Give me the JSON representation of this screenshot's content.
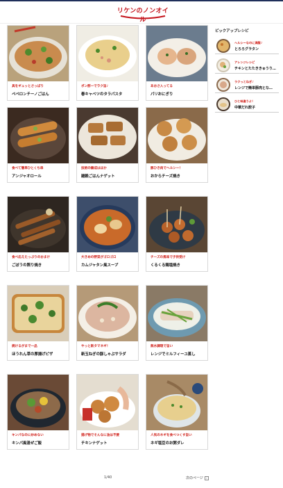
{
  "header": {
    "logo_text": "リケンのノンオイル"
  },
  "sidebar": {
    "heading": "ピックアップレシピ",
    "items": [
      {
        "tag": "ヘルシーなのに満腹♪",
        "title": "とろろグラタン"
      },
      {
        "tag": "アレンジレシピ",
        "title": "チキンとたたききゅうり…"
      },
      {
        "tag": "ラクっとねぎ♪",
        "title": "レンジで簡単豚肉とな…"
      },
      {
        "tag": "ひと味違うよ！",
        "title": "中華だれ餃子"
      }
    ]
  },
  "recipes": [
    {
      "tag": "具をギュッとさっぱり",
      "title": "ペペロンチーノごはん"
    },
    {
      "tag": "ポン酢ーでラク旨♪",
      "title": "春キャベツのタラパスタ"
    },
    {
      "tag": "あおさ入ってる",
      "title": "パリおにぎり"
    },
    {
      "tag": "食べて簡単ひとくち串",
      "title": "アンジャオロール"
    },
    {
      "tag": "技術の錬成はほか",
      "title": "雑穀ごはんナゲット"
    },
    {
      "tag": "豚ひき肉でヘルシー！",
      "title": "おからチーズ焼き"
    },
    {
      "tag": "食べ応えたっぷりのおまけ",
      "title": "ごぼうの照り焼き"
    },
    {
      "tag": "大きめの野菜がゴロゴロ",
      "title": "カムジャタン風スープ"
    },
    {
      "tag": "チーズの風味で子供受け",
      "title": "くるくる鶏塩焼き"
    },
    {
      "tag": "焼けるがまで一品",
      "title": "ほうれん草の厚揚げピザ"
    },
    {
      "tag": "やっと新タマネギ！",
      "title": "新玉ねぎの豚しゃぶサラダ"
    },
    {
      "tag": "無水調理で旨い",
      "title": "レンジでミルフィーユ蒸し"
    },
    {
      "tag": "キンパなのに炒めない",
      "title": "キンパ風混ぜご飯"
    },
    {
      "tag": "揚げ物でそんなに油は不要",
      "title": "チキンナゲット"
    },
    {
      "tag": "人気のネギを食べつくす旨い",
      "title": "ネギ塩豆のお粥ダレ"
    }
  ],
  "pagination": {
    "page": "1/40",
    "next_label": "次のページ"
  },
  "colors": {
    "accent": "#d0211a",
    "navy": "#1f2f5a"
  }
}
